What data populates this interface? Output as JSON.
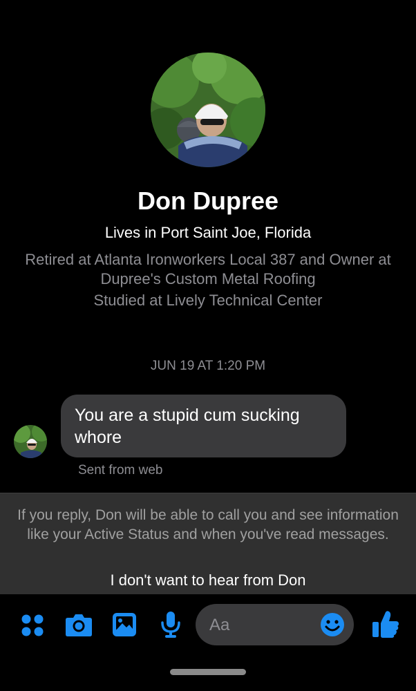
{
  "profile": {
    "name": "Don Dupree",
    "lives": "Lives in Port Saint Joe, Florida",
    "work": "Retired at Atlanta Ironworkers Local 387 and Owner at Dupree's Custom Metal Roofing",
    "education": "Studied at Lively Technical Center"
  },
  "conversation": {
    "timestamp": "JUN 19 AT 1:20 PM",
    "message": "You are a stupid cum sucking whore",
    "sent_from": "Sent from web"
  },
  "request_panel": {
    "notice": "If you reply, Don will be able to call you and see information like your Active Status and when you've read messages.",
    "ignore_label": "I don't want to hear from Don"
  },
  "composer": {
    "placeholder": "Aa",
    "icons": [
      "apps-icon",
      "camera-icon",
      "gallery-icon",
      "microphone-icon",
      "emoji-icon",
      "thumbs-up-icon"
    ]
  },
  "colors": {
    "accent": "#1b8cf2",
    "background": "#000000",
    "bubble": "#3a3a3c",
    "panel": "#303030",
    "muted_text": "#8e8e93"
  }
}
